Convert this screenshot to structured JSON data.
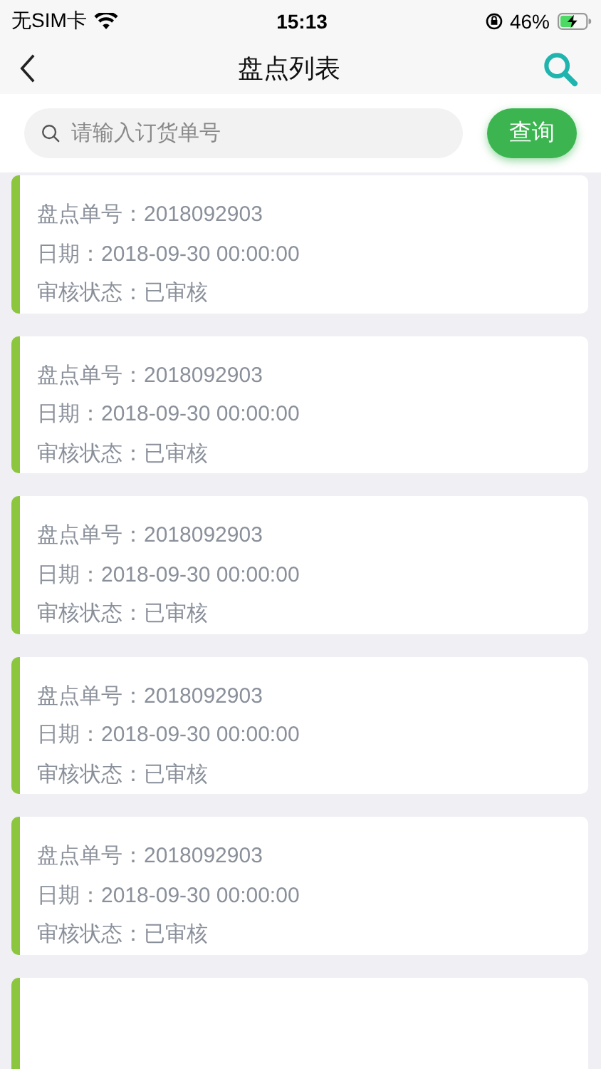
{
  "status_bar": {
    "carrier": "无SIM卡",
    "time": "15:13",
    "battery": "46%"
  },
  "nav": {
    "title": "盘点列表"
  },
  "search": {
    "placeholder": "请输入订货单号",
    "button": "查询"
  },
  "records": [
    {
      "number_label": "盘点单号：",
      "number": "2018092903",
      "date_label": "日期：",
      "date": "2018-09-30 00:00:00",
      "status_label": "审核状态：",
      "status": "已审核"
    },
    {
      "number_label": "盘点单号：",
      "number": "2018092903",
      "date_label": "日期：",
      "date": "2018-09-30 00:00:00",
      "status_label": "审核状态：",
      "status": "已审核"
    },
    {
      "number_label": "盘点单号：",
      "number": "2018092903",
      "date_label": "日期：",
      "date": "2018-09-30 00:00:00",
      "status_label": "审核状态：",
      "status": "已审核"
    },
    {
      "number_label": "盘点单号：",
      "number": "2018092903",
      "date_label": "日期：",
      "date": "2018-09-30 00:00:00",
      "status_label": "审核状态：",
      "status": "已审核"
    },
    {
      "number_label": "盘点单号：",
      "number": "2018092903",
      "date_label": "日期：",
      "date": "2018-09-30 00:00:00",
      "status_label": "审核状态：",
      "status": "已审核"
    }
  ]
}
